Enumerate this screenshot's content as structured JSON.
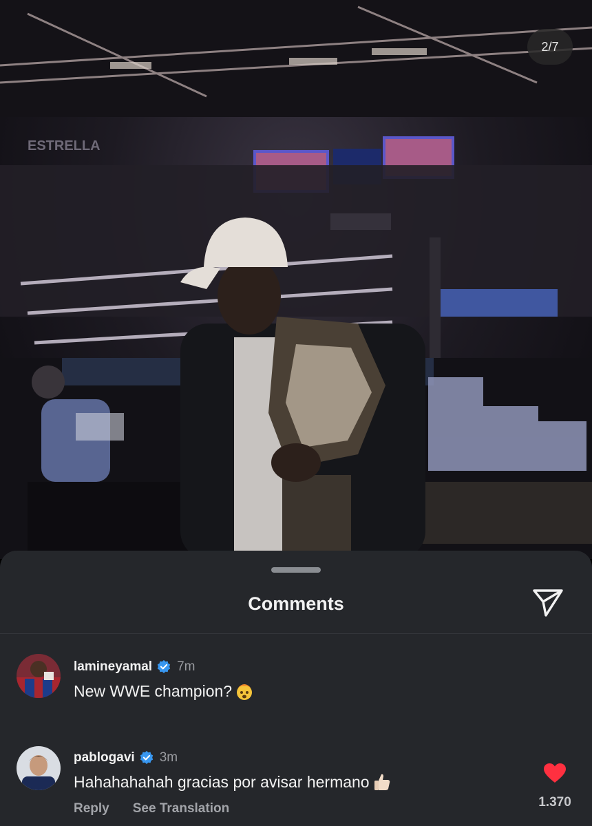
{
  "photo": {
    "counter": "2/7",
    "arena_sign": "ESTRELLA"
  },
  "comments_sheet": {
    "title": "Comments",
    "share_icon": "paper-plane-icon"
  },
  "comments": [
    {
      "username": "lamineyamal",
      "verified": true,
      "time": "7m",
      "text": "New WWE champion?",
      "emoji": "exploding-head-emoji"
    },
    {
      "username": "pablogavi",
      "verified": true,
      "time": "3m",
      "text": "Hahahahahah gracias por avisar hermano",
      "emoji": "thumbs-up-emoji",
      "reply_label": "Reply",
      "translate_label": "See Translation",
      "liked": true,
      "like_count": "1.370"
    }
  ],
  "colors": {
    "sheet_bg": "#25272b",
    "verified_blue": "#3897f0",
    "like_red": "#ff3040",
    "muted_text": "#9a9ca1"
  }
}
